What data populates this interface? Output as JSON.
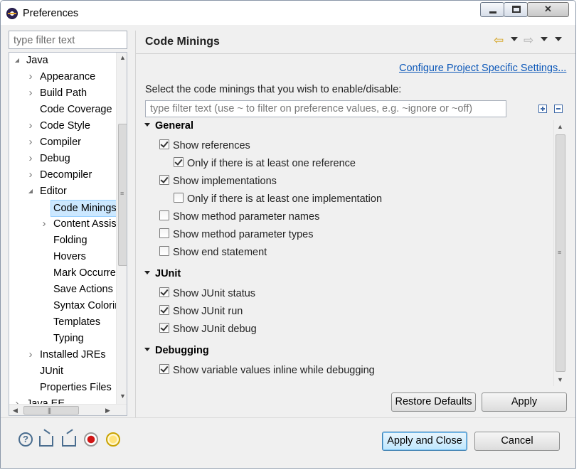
{
  "window": {
    "title": "Preferences"
  },
  "sidebar": {
    "filter_placeholder": "type filter text",
    "items": [
      {
        "label": "Java",
        "twisty": "expanded"
      },
      {
        "label": "Appearance",
        "twisty": "collapsed"
      },
      {
        "label": "Build Path",
        "twisty": "collapsed"
      },
      {
        "label": "Code Coverage",
        "twisty": "none"
      },
      {
        "label": "Code Style",
        "twisty": "collapsed"
      },
      {
        "label": "Compiler",
        "twisty": "collapsed"
      },
      {
        "label": "Debug",
        "twisty": "collapsed"
      },
      {
        "label": "Decompiler",
        "twisty": "collapsed"
      },
      {
        "label": "Editor",
        "twisty": "expanded"
      },
      {
        "label": "Code Minings",
        "twisty": "none",
        "selected": true
      },
      {
        "label": "Content Assist",
        "twisty": "collapsed"
      },
      {
        "label": "Folding",
        "twisty": "none"
      },
      {
        "label": "Hovers",
        "twisty": "none"
      },
      {
        "label": "Mark Occurrences",
        "twisty": "none"
      },
      {
        "label": "Save Actions",
        "twisty": "none"
      },
      {
        "label": "Syntax Coloring",
        "twisty": "none"
      },
      {
        "label": "Templates",
        "twisty": "none"
      },
      {
        "label": "Typing",
        "twisty": "none"
      },
      {
        "label": "Installed JREs",
        "twisty": "collapsed"
      },
      {
        "label": "JUnit",
        "twisty": "none"
      },
      {
        "label": "Properties Files",
        "twisty": "none"
      },
      {
        "label": "Java EE",
        "twisty": "collapsed"
      }
    ]
  },
  "page": {
    "title": "Code Minings",
    "configure_link": "Configure Project Specific Settings...",
    "intro": "Select the code minings that you wish to enable/disable:",
    "filter_placeholder": "type filter text (use ~ to filter on preference values, e.g. ~ignore or ~off)",
    "sections": [
      {
        "title": "General",
        "options": [
          {
            "label": "Show references",
            "checked": true,
            "indent": 0
          },
          {
            "label": "Only if there is at least one reference",
            "checked": true,
            "indent": 1
          },
          {
            "label": "Show implementations",
            "checked": true,
            "indent": 0
          },
          {
            "label": "Only if there is at least one implementation",
            "checked": false,
            "indent": 1
          },
          {
            "label": "Show method parameter names",
            "checked": false,
            "indent": 0
          },
          {
            "label": "Show method parameter types",
            "checked": false,
            "indent": 0
          },
          {
            "label": "Show end statement",
            "checked": false,
            "indent": 0
          }
        ]
      },
      {
        "title": "JUnit",
        "options": [
          {
            "label": "Show JUnit status",
            "checked": true,
            "indent": 0
          },
          {
            "label": "Show JUnit run",
            "checked": true,
            "indent": 0
          },
          {
            "label": "Show JUnit debug",
            "checked": true,
            "indent": 0
          }
        ]
      },
      {
        "title": "Debugging",
        "options": [
          {
            "label": "Show variable values inline while debugging",
            "checked": true,
            "indent": 0
          }
        ]
      }
    ],
    "restore_defaults_label": "Restore Defaults",
    "apply_label": "Apply"
  },
  "footer": {
    "apply_close_label": "Apply and Close",
    "cancel_label": "Cancel",
    "icons": [
      "help-icon",
      "import-icon",
      "export-icon",
      "record-icon",
      "lightbulb-icon"
    ]
  },
  "colors": {
    "link": "#0b57b8",
    "selection": "#cce8ff",
    "back_arrow": "#d4a017"
  }
}
